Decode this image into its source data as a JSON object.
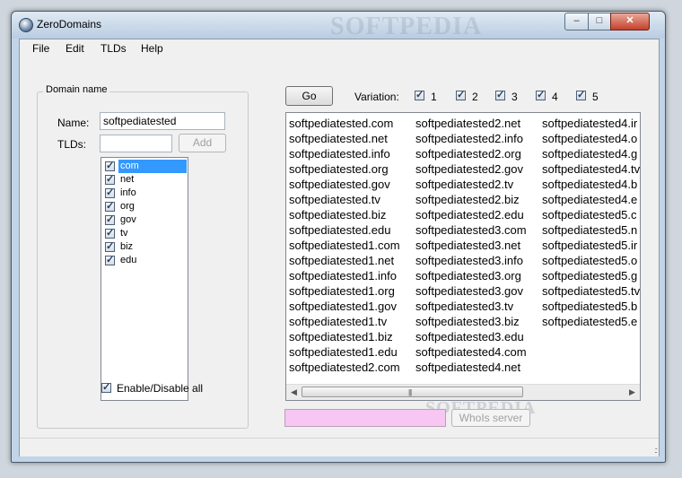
{
  "window": {
    "title": "ZeroDomains",
    "watermark": "SOFTPEDIA",
    "close_glyph": "✕",
    "max_glyph": "□",
    "min_glyph": "–"
  },
  "menu": [
    {
      "label": "File"
    },
    {
      "label": "Edit"
    },
    {
      "label": "TLDs"
    },
    {
      "label": "Help"
    }
  ],
  "domain_group": {
    "label": "Domain name",
    "name_label": "Name:",
    "name_value": "softpediatested",
    "tlds_label": "TLDs:",
    "tlds_value": "",
    "add_label": "Add",
    "tld_list": [
      {
        "label": "com",
        "checked": true,
        "selected": true
      },
      {
        "label": "net",
        "checked": true
      },
      {
        "label": "info",
        "checked": true
      },
      {
        "label": "org",
        "checked": true
      },
      {
        "label": "gov",
        "checked": true
      },
      {
        "label": "tv",
        "checked": true
      },
      {
        "label": "biz",
        "checked": true
      },
      {
        "label": "edu",
        "checked": true
      }
    ],
    "enable_all_label": "Enable/Disable all",
    "enable_all_checked": true
  },
  "controls": {
    "go_label": "Go",
    "variation_label": "Variation:",
    "variations": [
      {
        "label": "1",
        "checked": true
      },
      {
        "label": "2",
        "checked": true
      },
      {
        "label": "3",
        "checked": true
      },
      {
        "label": "4",
        "checked": true
      },
      {
        "label": "5",
        "checked": true
      }
    ],
    "whois_label": "WhoIs server",
    "watermark": "SOFTPEDIA"
  },
  "results": {
    "col1": [
      "softpediatested.com",
      "softpediatested.net",
      "softpediatested.info",
      "softpediatested.org",
      "softpediatested.gov",
      "softpediatested.tv",
      "softpediatested.biz",
      "softpediatested.edu",
      "softpediatested1.com",
      "softpediatested1.net",
      "softpediatested1.info",
      "softpediatested1.org",
      "softpediatested1.gov",
      "softpediatested1.tv",
      "softpediatested1.biz",
      "softpediatested1.edu",
      "softpediatested2.com"
    ],
    "col2": [
      "softpediatested2.net",
      "softpediatested2.info",
      "softpediatested2.org",
      "softpediatested2.gov",
      "softpediatested2.tv",
      "softpediatested2.biz",
      "softpediatested2.edu",
      "softpediatested3.com",
      "softpediatested3.net",
      "softpediatested3.info",
      "softpediatested3.org",
      "softpediatested3.gov",
      "softpediatested3.tv",
      "softpediatested3.biz",
      "softpediatested3.edu",
      "softpediatested4.com",
      "softpediatested4.net"
    ],
    "col3": [
      "softpediatested4.ir",
      "softpediatested4.o",
      "softpediatested4.g",
      "softpediatested4.tv",
      "softpediatested4.b",
      "softpediatested4.e",
      "softpediatested5.c",
      "softpediatested5.n",
      "softpediatested5.ir",
      "softpediatested5.o",
      "softpediatested5.g",
      "softpediatested5.tv",
      "softpediatested5.b",
      "softpediatested5.e"
    ]
  }
}
